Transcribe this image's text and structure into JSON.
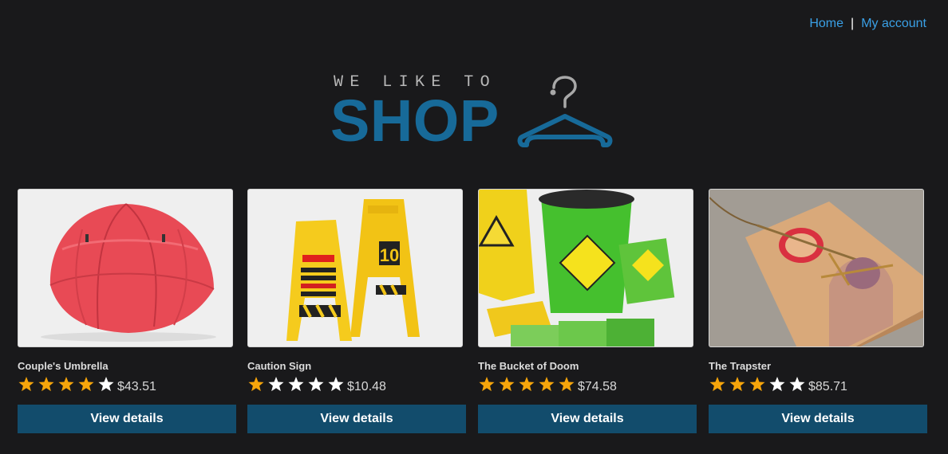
{
  "nav": {
    "home_label": "Home",
    "separator": "|",
    "account_label": "My account"
  },
  "logo": {
    "tagline": "WE LIKE TO",
    "wordmark": "SHOP",
    "icon": "hanger-icon"
  },
  "colors": {
    "background": "#19191b",
    "link": "#3aa0e6",
    "brand_blue": "#176a99",
    "button": "#124c6c",
    "star_filled": "#f6a50b",
    "star_empty": "#ffffff"
  },
  "products": [
    {
      "name": "Couple's Umbrella",
      "rating": 4,
      "rating_max": 5,
      "price": "$43.51",
      "button_label": "View details",
      "image_icon": "red-umbrella-image"
    },
    {
      "name": "Caution Sign",
      "rating": 1,
      "rating_max": 5,
      "price": "$10.48",
      "button_label": "View details",
      "image_icon": "yellow-caution-sign-image"
    },
    {
      "name": "The Bucket of Doom",
      "rating": 5,
      "rating_max": 5,
      "price": "$74.58",
      "button_label": "View details",
      "image_icon": "green-bucket-image"
    },
    {
      "name": "The Trapster",
      "rating": 3,
      "rating_max": 5,
      "price": "$85.71",
      "button_label": "View details",
      "image_icon": "mousetrap-image"
    }
  ]
}
